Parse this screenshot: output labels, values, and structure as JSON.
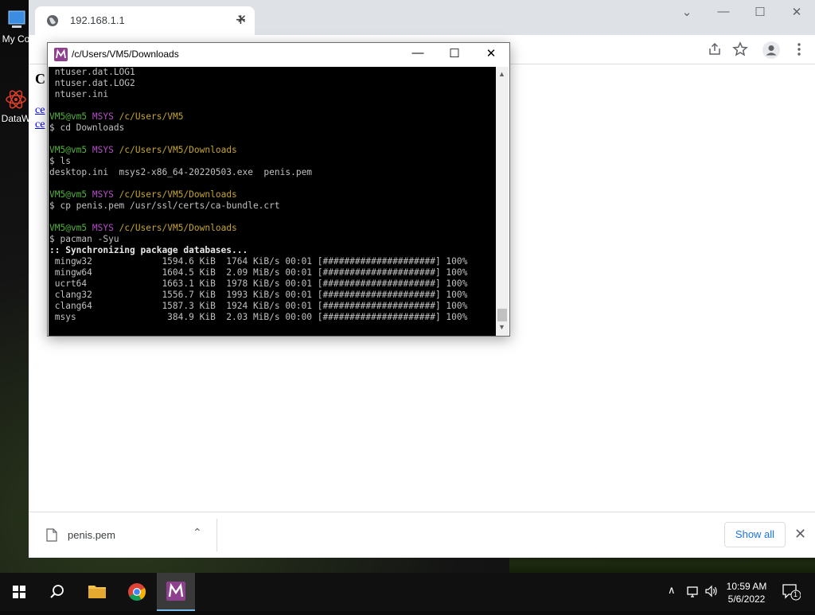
{
  "desktop": {
    "icons": [
      {
        "label": "My Co"
      },
      {
        "label": "DataW"
      }
    ]
  },
  "browser": {
    "tab_title": "192.168.1.1",
    "tab_close_glyph": "✕",
    "new_tab_glyph": "+",
    "window_controls": {
      "dropdown": "⌄",
      "minimize": "—",
      "maximize": "☐",
      "close": "✕"
    },
    "page": {
      "heading": "C",
      "links": [
        "ce",
        "ce"
      ]
    },
    "download_bar": {
      "file_name": "penis.pem",
      "chevron": "⌃",
      "show_all": "Show all",
      "close": "✕"
    }
  },
  "terminal": {
    "title": "/c/Users/VM5/Downloads",
    "controls": {
      "minimize": "—",
      "maximize": "☐",
      "close": "✕"
    },
    "lines": [
      {
        "type": "out",
        "text": " ntuser.dat.LOG1"
      },
      {
        "type": "out",
        "text": " ntuser.dat.LOG2"
      },
      {
        "type": "out",
        "text": " ntuser.ini"
      },
      {
        "type": "blank",
        "text": ""
      },
      {
        "type": "prompt",
        "user": "VM5@vm5",
        "env": "MSYS",
        "path": "/c/Users/VM5"
      },
      {
        "type": "out",
        "text": "$ cd Downloads"
      },
      {
        "type": "blank",
        "text": ""
      },
      {
        "type": "prompt",
        "user": "VM5@vm5",
        "env": "MSYS",
        "path": "/c/Users/VM5/Downloads"
      },
      {
        "type": "out",
        "text": "$ ls"
      },
      {
        "type": "out",
        "text": "desktop.ini  msys2-x86_64-20220503.exe  penis.pem"
      },
      {
        "type": "blank",
        "text": ""
      },
      {
        "type": "prompt",
        "user": "VM5@vm5",
        "env": "MSYS",
        "path": "/c/Users/VM5/Downloads"
      },
      {
        "type": "out",
        "text": "$ cp penis.pem /usr/ssl/certs/ca-bundle.crt"
      },
      {
        "type": "blank",
        "text": ""
      },
      {
        "type": "prompt",
        "user": "VM5@vm5",
        "env": "MSYS",
        "path": "/c/Users/VM5/Downloads"
      },
      {
        "type": "out",
        "text": "$ pacman -Syu"
      },
      {
        "type": "bold",
        "text": ":: Synchronizing package databases..."
      },
      {
        "type": "out",
        "text": " mingw32             1594.6 KiB  1764 KiB/s 00:01 [#####################] 100%"
      },
      {
        "type": "out",
        "text": " mingw64             1604.5 KiB  2.09 MiB/s 00:01 [#####################] 100%"
      },
      {
        "type": "out",
        "text": " ucrt64              1663.1 KiB  1978 KiB/s 00:01 [#####################] 100%"
      },
      {
        "type": "out",
        "text": " clang32             1556.7 KiB  1993 KiB/s 00:01 [#####################] 100%"
      },
      {
        "type": "out",
        "text": " clang64             1587.3 KiB  1924 KiB/s 00:01 [#####################] 100%"
      },
      {
        "type": "out",
        "text": " msys                 384.9 KiB  2.03 MiB/s 00:00 [#####################] 100%"
      }
    ],
    "scroll": {
      "up": "▲",
      "down": "▼"
    }
  },
  "taskbar": {
    "clock_time": "10:59 AM",
    "clock_date": "5/6/2022",
    "notification_count": "1",
    "tray_chevron": "∧"
  },
  "colors": {
    "prompt_user": "#52b23a",
    "prompt_env": "#b24ec5",
    "prompt_path": "#c4a530",
    "msys_brand": "#8e3f8e",
    "link": "#0000ee",
    "accent": "#1a73e8"
  }
}
